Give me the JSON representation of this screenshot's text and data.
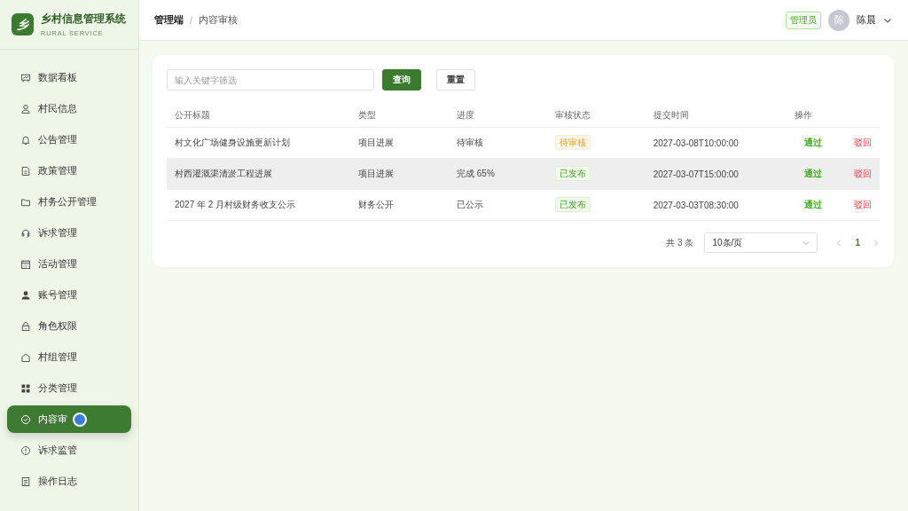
{
  "app": {
    "logo": "乡",
    "title": "乡村信息管理系统",
    "subtitle": "RURAL SERVICE"
  },
  "sidebar": {
    "items": [
      {
        "label": "数据看板",
        "selected": false
      },
      {
        "label": "村民信息",
        "selected": false
      },
      {
        "label": "公告管理",
        "selected": false
      },
      {
        "label": "政策管理",
        "selected": false
      },
      {
        "label": "村务公开管理",
        "selected": false
      },
      {
        "label": "诉求管理",
        "selected": false
      },
      {
        "label": "活动管理",
        "selected": false
      },
      {
        "label": "账号管理",
        "selected": false
      },
      {
        "label": "角色权限",
        "selected": false
      },
      {
        "label": "村组管理",
        "selected": false
      },
      {
        "label": "分类管理",
        "selected": false
      },
      {
        "label": "内容审",
        "selected": true
      },
      {
        "label": "诉求监管",
        "selected": false
      },
      {
        "label": "操作日志",
        "selected": false
      }
    ]
  },
  "header": {
    "breadcrumb": [
      "管理端",
      "内容审核"
    ],
    "breadcrumb_separator": "/",
    "role_badge": "管理员",
    "avatar": "陈",
    "user": "陈晨"
  },
  "filter": {
    "placeholder": "输入关键字筛选",
    "buttons": [
      {
        "label": "查询",
        "kind": "primary"
      },
      {
        "label": "重置",
        "kind": "default"
      }
    ]
  },
  "table": {
    "columns": [
      "公开标题",
      "类型",
      "进度",
      "审核状态",
      "提交时间",
      "操作"
    ],
    "rows": [
      {
        "title": "村文化广场健身设施更新计划",
        "type": "项目进展",
        "progress": "待审核",
        "status": {
          "label": "待审核",
          "kind": "pending"
        },
        "time": "2027-03-08T10:00:00",
        "actions": [
          "通过",
          "驳回"
        ],
        "highlighted": false
      },
      {
        "title": "村西灌溉渠清淤工程进展",
        "type": "项目进展",
        "progress": "完成 65%",
        "status": {
          "label": "已发布",
          "kind": "published"
        },
        "time": "2027-03-07T15:00:00",
        "actions": [
          "通过",
          "驳回"
        ],
        "highlighted": true
      },
      {
        "title": "2027 年 2 月村级财务收支公示",
        "type": "财务公开",
        "progress": "已公示",
        "status": {
          "label": "已发布",
          "kind": "published"
        },
        "time": "2027-03-03T08:30:00",
        "actions": [
          "通过",
          "驳回"
        ],
        "highlighted": false
      }
    ]
  },
  "pagination": {
    "total": "共 3 条",
    "page_size": "10条/页",
    "pages": [
      {
        "label": "1",
        "selected": true
      }
    ]
  }
}
